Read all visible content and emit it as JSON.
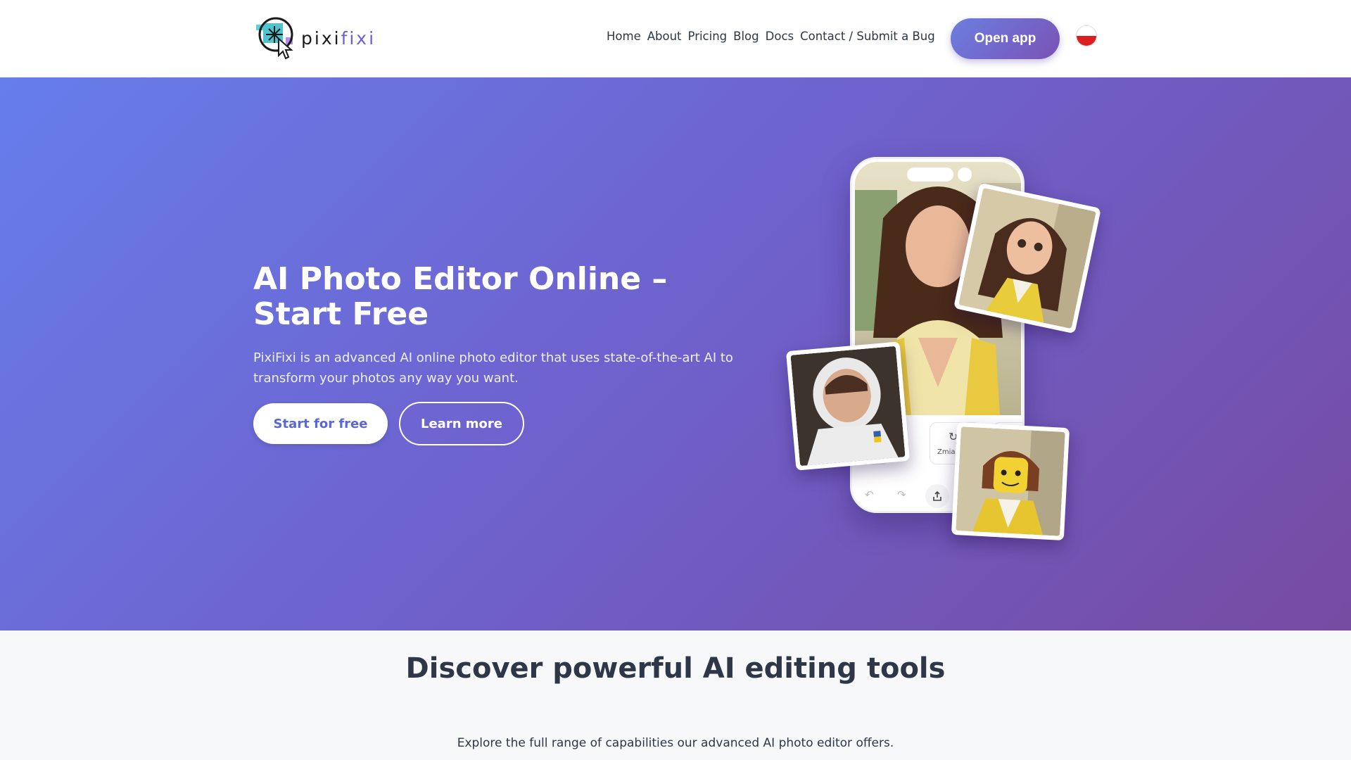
{
  "header": {
    "logo_text_a": "pixi",
    "logo_text_b": "fixi",
    "nav": [
      "Home",
      "About",
      "Pricing",
      "Blog",
      "Docs",
      "Contact / Submit a Bug"
    ],
    "open_app_label": "Open app",
    "language_flag": "polish-flag-icon"
  },
  "hero": {
    "title": "AI Photo Editor Online – Start Free",
    "subtitle": "PixiFixi is an advanced AI online photo editor that uses state-of-the-art AI to transform your photos any way you want.",
    "start_label": "Start for free",
    "learn_label": "Learn more",
    "phone_tool_label": "Zmia"
  },
  "section2": {
    "title": "Discover powerful AI editing tools",
    "subtitle": "Explore the full range of capabilities our advanced AI photo editor offers."
  },
  "colors": {
    "hero_start": "#667eea",
    "hero_end": "#764ba2",
    "accent": "#5a67d8",
    "flag_white": "#ffffff",
    "flag_red": "#dc1e22"
  }
}
